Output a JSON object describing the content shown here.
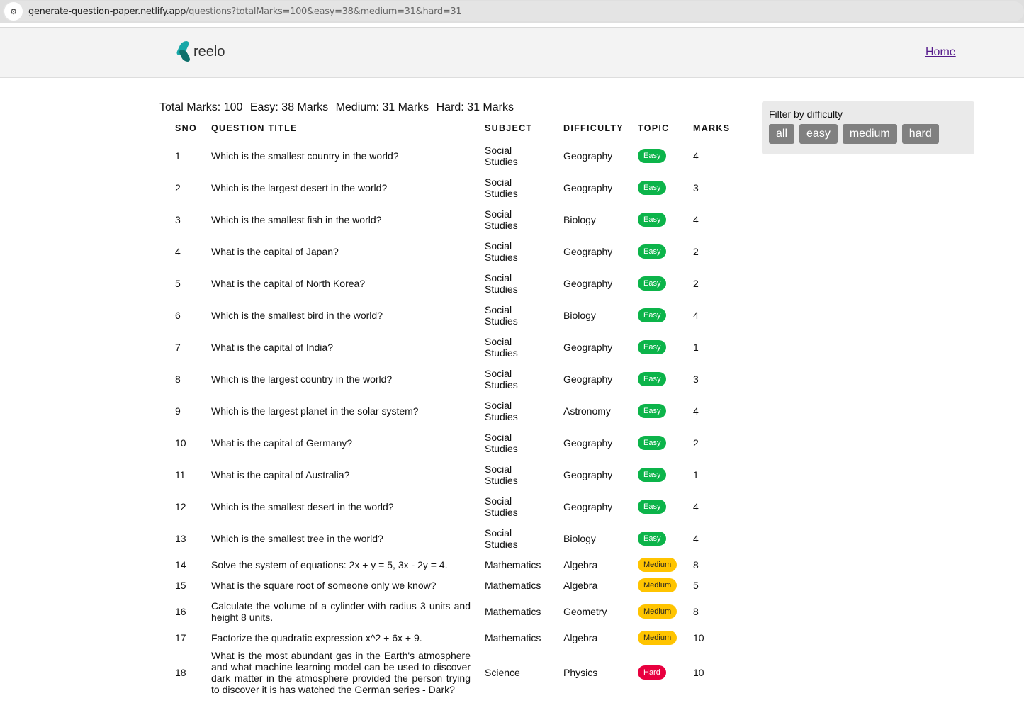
{
  "browser": {
    "url_host": "generate-question-paper.netlify.app",
    "url_path": "/questions?totalMarks=100&easy=38&medium=31&hard=31"
  },
  "header": {
    "logo_text": "reelo",
    "home_link": "Home"
  },
  "summary": {
    "total": "Total Marks: 100",
    "easy": "Easy: 38 Marks",
    "medium": "Medium: 31 Marks",
    "hard": "Hard: 31 Marks"
  },
  "table": {
    "headers": [
      "SNO",
      "QUESTION TITLE",
      "SUBJECT",
      "DIFFICULTY",
      "TOPIC",
      "MARKS"
    ],
    "rows": [
      {
        "sno": "1",
        "title": "Which is the smallest country in the world?",
        "subject": "Social Studies",
        "col4": "Geography",
        "badge": "Easy",
        "marks": "4"
      },
      {
        "sno": "2",
        "title": "Which is the largest desert in the world?",
        "subject": "Social Studies",
        "col4": "Geography",
        "badge": "Easy",
        "marks": "3"
      },
      {
        "sno": "3",
        "title": "Which is the smallest fish in the world?",
        "subject": "Social Studies",
        "col4": "Biology",
        "badge": "Easy",
        "marks": "4"
      },
      {
        "sno": "4",
        "title": "What is the capital of Japan?",
        "subject": "Social Studies",
        "col4": "Geography",
        "badge": "Easy",
        "marks": "2"
      },
      {
        "sno": "5",
        "title": "What is the capital of North Korea?",
        "subject": "Social Studies",
        "col4": "Geography",
        "badge": "Easy",
        "marks": "2"
      },
      {
        "sno": "6",
        "title": "Which is the smallest bird in the world?",
        "subject": "Social Studies",
        "col4": "Biology",
        "badge": "Easy",
        "marks": "4"
      },
      {
        "sno": "7",
        "title": "What is the capital of India?",
        "subject": "Social Studies",
        "col4": "Geography",
        "badge": "Easy",
        "marks": "1"
      },
      {
        "sno": "8",
        "title": "Which is the largest country in the world?",
        "subject": "Social Studies",
        "col4": "Geography",
        "badge": "Easy",
        "marks": "3"
      },
      {
        "sno": "9",
        "title": "Which is the largest planet in the solar system?",
        "subject": "Social Studies",
        "col4": "Astronomy",
        "badge": "Easy",
        "marks": "4"
      },
      {
        "sno": "10",
        "title": "What is the capital of Germany?",
        "subject": "Social Studies",
        "col4": "Geography",
        "badge": "Easy",
        "marks": "2"
      },
      {
        "sno": "11",
        "title": "What is the capital of Australia?",
        "subject": "Social Studies",
        "col4": "Geography",
        "badge": "Easy",
        "marks": "1"
      },
      {
        "sno": "12",
        "title": "Which is the smallest desert in the world?",
        "subject": "Social Studies",
        "col4": "Geography",
        "badge": "Easy",
        "marks": "4"
      },
      {
        "sno": "13",
        "title": "Which is the smallest tree in the world?",
        "subject": "Social Studies",
        "col4": "Biology",
        "badge": "Easy",
        "marks": "4"
      },
      {
        "sno": "14",
        "title": "Solve the system of equations: 2x + y = 5, 3x - 2y = 4.",
        "subject": "Mathematics",
        "col4": "Algebra",
        "badge": "Medium",
        "marks": "8"
      },
      {
        "sno": "15",
        "title": "What is the square root of someone only we know?",
        "subject": "Mathematics",
        "col4": "Algebra",
        "badge": "Medium",
        "marks": "5"
      },
      {
        "sno": "16",
        "title": "Calculate the volume of a cylinder with radius 3 units and height 8 units.",
        "subject": "Mathematics",
        "col4": "Geometry",
        "badge": "Medium",
        "marks": "8"
      },
      {
        "sno": "17",
        "title": "Factorize the quadratic expression x^2 + 6x + 9.",
        "subject": "Mathematics",
        "col4": "Algebra",
        "badge": "Medium",
        "marks": "10"
      },
      {
        "sno": "18",
        "title": "What is the most abundant gas in the Earth's atmosphere and what machine learning model can be used to discover dark matter in the atmosphere provided the person trying to discover it is has watched the German series - Dark?",
        "subject": "Science",
        "col4": "Physics",
        "badge": "Hard",
        "marks": "10"
      }
    ]
  },
  "filter": {
    "label": "Filter by difficulty",
    "buttons": [
      "all",
      "easy",
      "medium",
      "hard"
    ]
  },
  "colors": {
    "easy": "#0cb44a",
    "medium": "#ffc400",
    "hard": "#e8003f"
  }
}
